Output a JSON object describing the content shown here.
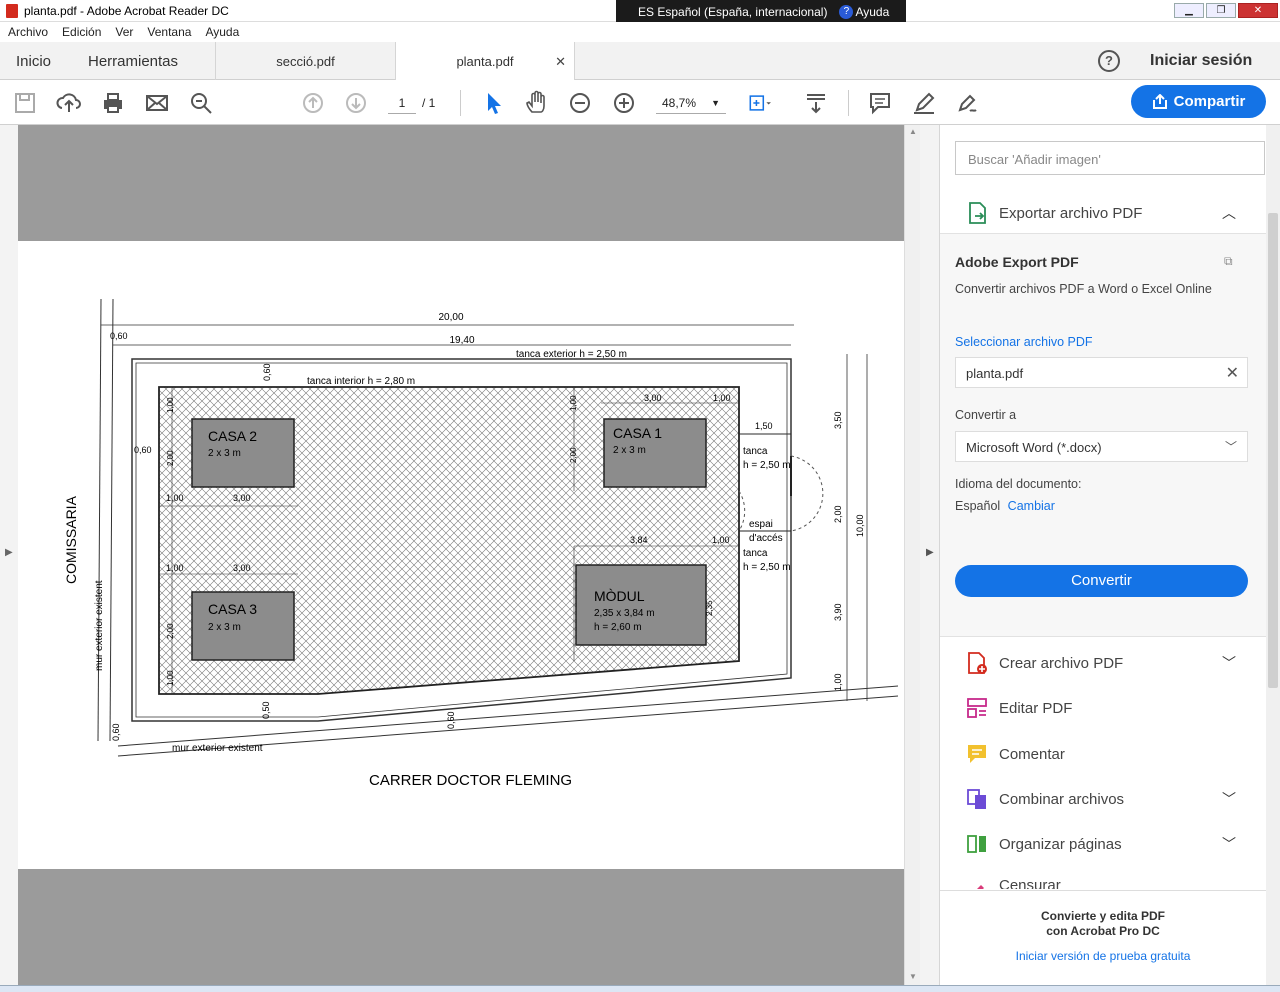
{
  "window": {
    "title": "planta.pdf - Adobe Acrobat Reader DC"
  },
  "langbar": {
    "lang": "ES Español (España, internacional)",
    "help": "Ayuda"
  },
  "menu": [
    "Archivo",
    "Edición",
    "Ver",
    "Ventana",
    "Ayuda"
  ],
  "tabs": {
    "home": "Inicio",
    "tools": "Herramientas",
    "doc1": "secció.pdf",
    "doc2": "planta.pdf",
    "signin": "Iniciar sesión"
  },
  "toolbar": {
    "page_current": "1",
    "page_total": "/ 1",
    "zoom": "48,7%",
    "share": "Compartir"
  },
  "plan": {
    "dim_20": "20,00",
    "dim_1940": "19,40",
    "dim_060a": "0,60",
    "dim_060b": "0,60",
    "dim_060c": "0,60",
    "dim_060d": "0,60",
    "dim_060e": "0,60",
    "dim_050a": "0,50",
    "tanca_ext": "tanca exterior  h = 2,50 m",
    "tanca_int": "tanca interior  h = 2,80 m",
    "casa2": "CASA 2",
    "casa2_dim": "2 x 3 m",
    "casa1": "CASA 1",
    "casa1_dim": "2 x 3 m",
    "casa3": "CASA 3",
    "casa3_dim": "2 x 3 m",
    "modul": "MÒDUL",
    "modul_dim": "2,35 x 3,84 m",
    "modul_h": "h = 2,60 m",
    "d100a": "1,00",
    "d200a": "2,00",
    "d100b": "1,00",
    "d300a": "3,00",
    "d100c": "1,00",
    "d300b": "3,00",
    "d100d": "1,00",
    "d300c": "3,00",
    "d100e": "1,00",
    "d200b": "2,00",
    "d100f": "1,00",
    "d200c": "2,00",
    "d300d": "3,00",
    "d100g": "1,00",
    "d150": "1,50",
    "d384": "3,84",
    "d100h": "1,00",
    "d235": "2,35",
    "d350": "3,50",
    "d200d": "2,00",
    "d390": "3,90",
    "d1000": "10,00",
    "tanca1": "tanca",
    "tanca1_h": "h = 2,50 m",
    "tanca2": "tanca",
    "tanca2_h": "h = 2,50 m",
    "espai1": "espai",
    "espai2": "d'accés",
    "comissaria": "COMISSARIA",
    "mur1": "mur exterior existent",
    "mur2": "mur exterior existent",
    "street": "CARRER DOCTOR FLEMING"
  },
  "panel": {
    "search_placeholder": "Buscar 'Añadir imagen'",
    "export_header": "Exportar archivo PDF",
    "export_title": "Adobe Export PDF",
    "export_sub": "Convertir archivos PDF a Word o Excel Online",
    "select_link": "Seleccionar archivo PDF",
    "file": "planta.pdf",
    "convert_to": "Convertir a",
    "format": "Microsoft Word (*.docx)",
    "lang_label": "Idioma del documento:",
    "lang_value": "Español",
    "lang_change": "Cambiar",
    "convert_btn": "Convertir",
    "tools": [
      "Crear archivo PDF",
      "Editar PDF",
      "Comentar",
      "Combinar archivos",
      "Organizar páginas",
      "Censurar"
    ],
    "promo1": "Convierte y edita PDF",
    "promo2": "con Acrobat Pro DC",
    "promo_link": "Iniciar versión de prueba gratuita"
  },
  "colors": {
    "accent": "#1473e6",
    "pdf_red": "#d32b1e"
  }
}
